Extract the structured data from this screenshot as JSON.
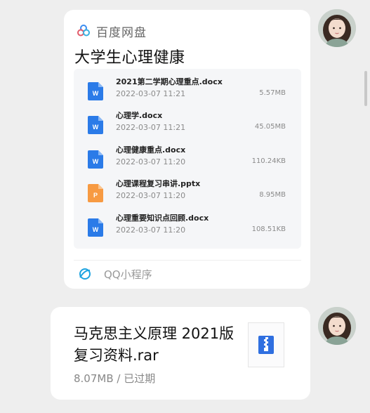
{
  "colors": {
    "background": "#eeeeee",
    "card": "#ffffff",
    "word_icon": "#2b7be8",
    "ppt_icon": "#f79a42",
    "zip_icon": "#2f6fe0",
    "brand_blue": "#3b8cf0",
    "qq_miniprogram": "#1ca3e0"
  },
  "message1": {
    "avatar_icon": "user-avatar",
    "app_name": "百度网盘",
    "app_icon": "baidu-netdisk-logo",
    "share_title": "大学生心理健康",
    "files": [
      {
        "icon": "word-file-icon",
        "name": "2021第二学期心理重点.docx",
        "time": "2022-03-07  11:21",
        "size": "5.57MB"
      },
      {
        "icon": "word-file-icon",
        "name": "心理学.docx",
        "time": "2022-03-07  11:21",
        "size": "45.05MB"
      },
      {
        "icon": "word-file-icon",
        "name": "心理健康重点.docx",
        "time": "2022-03-07  11:20",
        "size": "110.24KB"
      },
      {
        "icon": "ppt-file-icon",
        "name": "心理课程复习串讲.pptx",
        "time": "2022-03-07  11:20",
        "size": "8.95MB"
      },
      {
        "icon": "word-file-icon",
        "name": "心理重要知识点回顾.docx",
        "time": "2022-03-07  11:20",
        "size": "108.51KB"
      }
    ],
    "source_label": "QQ小程序",
    "source_icon": "qq-miniprogram-icon"
  },
  "message2": {
    "avatar_icon": "user-avatar",
    "file_title": "马克思主义原理 2021版复习资料.rar",
    "file_meta": "8.07MB / 已过期",
    "thumb_icon": "archive-file-icon"
  }
}
